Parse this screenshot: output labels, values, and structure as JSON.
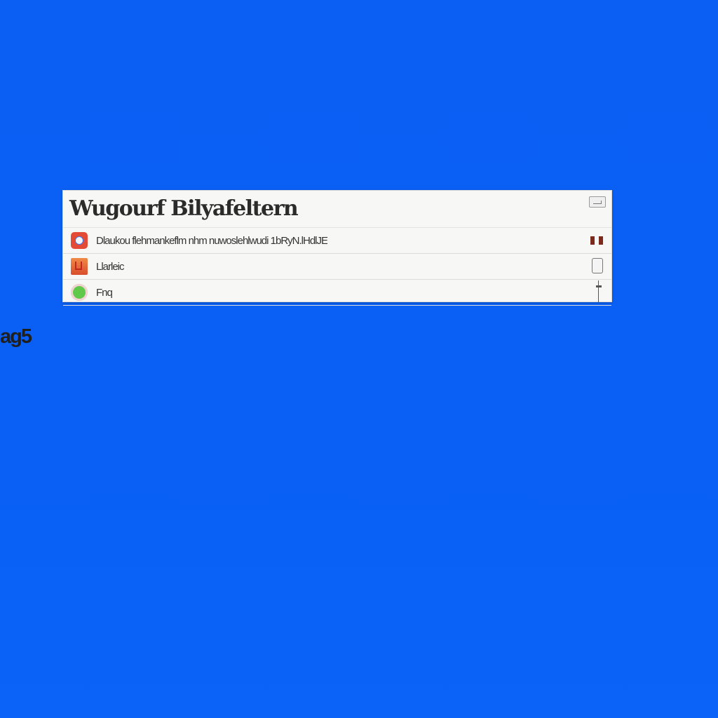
{
  "screen": {
    "background_color": "#0b5ff3",
    "desktop_label": "ag5"
  },
  "window": {
    "title": "Wugourf Bilyafeltern",
    "header_button_icon": "window-button-icon",
    "items": [
      {
        "icon": "chrome-icon",
        "label": "Dlaukou flehmankeflm nhm nuwoslehlwudi 1bRyN.lHdlJE",
        "control": "pause-control"
      },
      {
        "icon": "files-icon",
        "label": "Llarleic",
        "control": "toggle-control"
      },
      {
        "icon": "green-circle-icon",
        "label": "Fnq",
        "control": "slider-control"
      }
    ]
  }
}
